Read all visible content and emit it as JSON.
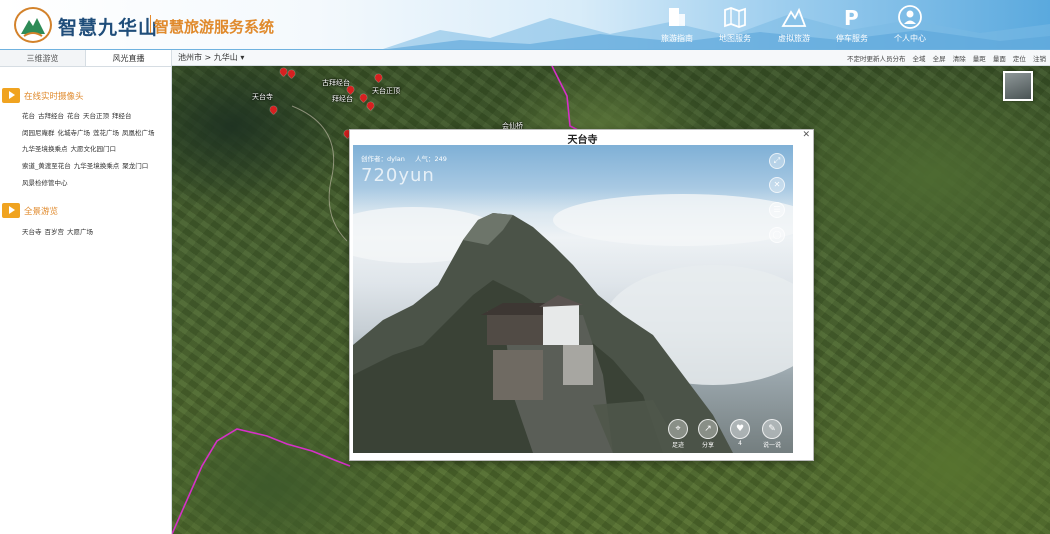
{
  "app": {
    "title": "智慧九华山",
    "subtitle": "智慧旅游服务系统"
  },
  "nav": [
    {
      "label": "旅游指南",
      "icon": "building-icon"
    },
    {
      "label": "地图服务",
      "icon": "map-icon"
    },
    {
      "label": "虚拟旅游",
      "icon": "mountain-icon"
    },
    {
      "label": "停车服务",
      "icon": "parking-icon"
    },
    {
      "label": "个人中心",
      "icon": "user-icon"
    }
  ],
  "left_panel": {
    "tabs": [
      "三维游览",
      "风光直播"
    ],
    "active_tab": 1,
    "section1_title": "在线实时摄像头",
    "section1_rows": [
      [
        "花台",
        "古拜经台",
        "花台",
        "天台正顶",
        "拜经台"
      ],
      [
        "闵园尼庵群",
        "化城寺广场",
        "莲花广场",
        "凤凰松广场"
      ],
      [
        "九华圣境换乘点",
        "大愿文化园门口"
      ],
      [
        "索道_黄渡至花台",
        "九华圣境换乘点",
        "聚龙门口"
      ],
      [
        "风景检修管中心"
      ]
    ],
    "section2_title": "全景游览",
    "section2_rows": [
      [
        "天台寺",
        "百岁宫",
        "大愿广场"
      ]
    ]
  },
  "toolbar": {
    "breadcrumb": "池州市 > 九华山 ▾",
    "tools": [
      "不定时更新人员分布",
      "全域",
      "全屏",
      "清除",
      "量距",
      "量面",
      "定位",
      "注销"
    ]
  },
  "map_labels": [
    {
      "text": "天台寺",
      "name": "map-label-tiantai"
    },
    {
      "text": "古拜经台",
      "name": "map-label-baijing"
    },
    {
      "text": "拜经台",
      "name": "map-label-baijingtai"
    },
    {
      "text": "天台正顶",
      "name": "map-label-zhengding"
    },
    {
      "text": "会仙桥",
      "name": "map-label-huixian"
    }
  ],
  "panorama": {
    "title": "天台寺",
    "author_label": "创作者：dylan",
    "popularity_label": "人气：249",
    "view_count": "720yun",
    "side_buttons": [
      "⤢",
      "✕",
      "☰",
      "◯"
    ],
    "actions": [
      {
        "icon": "location-icon",
        "glyph": "⌖",
        "label": "足迹"
      },
      {
        "icon": "share-icon",
        "glyph": "↗",
        "label": "分享"
      },
      {
        "icon": "like-icon",
        "glyph": "♥",
        "label": "4"
      },
      {
        "icon": "comment-icon",
        "glyph": "✎",
        "label": "说一说"
      }
    ]
  },
  "colors": {
    "accent_orange": "#e08a2c",
    "title_blue": "#1f4d7a",
    "route_magenta": "#d630c8"
  }
}
